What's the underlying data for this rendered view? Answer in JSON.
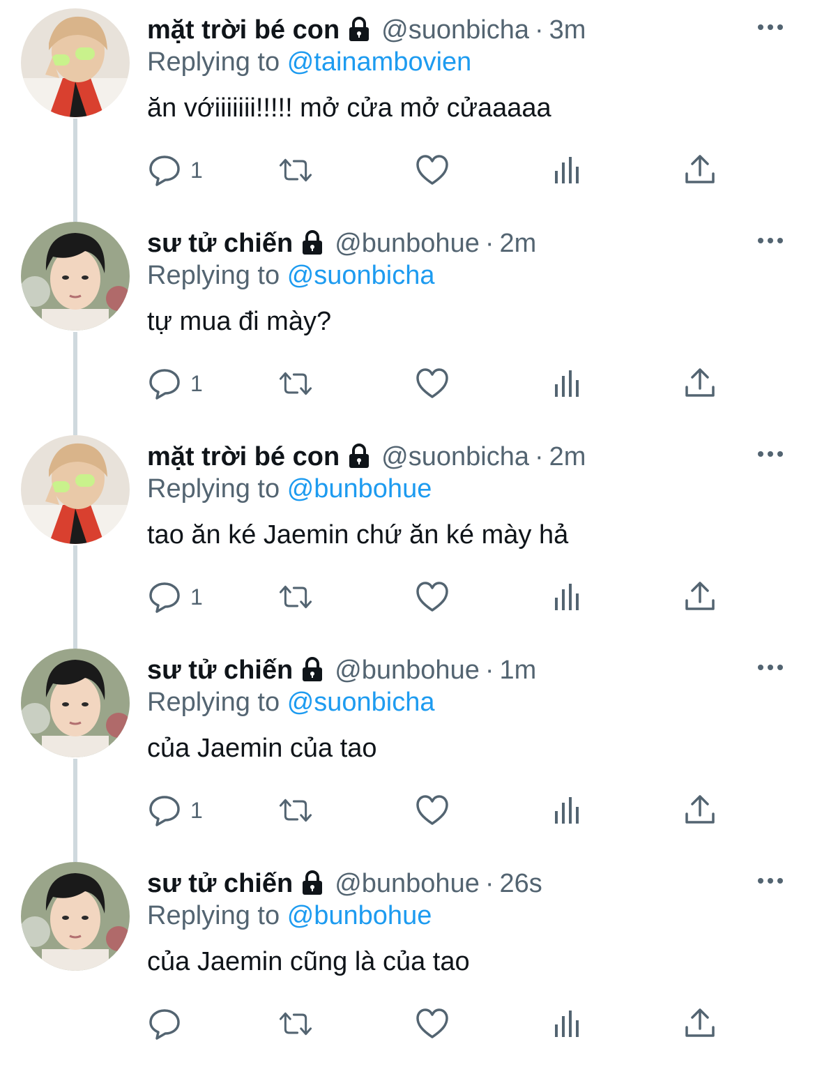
{
  "colors": {
    "text": "#0f1419",
    "secondary": "#536471",
    "link": "#1d9bf0",
    "thread_line": "#cfd9de",
    "icon": "#536471"
  },
  "tweets": [
    {
      "name": "mặt trời bé con",
      "handle": "@suonbicha",
      "time": "3m",
      "replying_prefix": "Replying to",
      "reply_to": "@tainambovien",
      "text": "ăn vớiiiiiii!!!!! mở cửa mở cửaaaaa",
      "reply_count": "1",
      "avatar": "sun-avatar",
      "locked": true
    },
    {
      "name": "sư tử chiến",
      "handle": "@bunbohue",
      "time": "2m",
      "replying_prefix": "Replying to",
      "reply_to": "@suonbicha",
      "text": "tự mua đi mày?",
      "reply_count": "1",
      "avatar": "lion-avatar",
      "locked": true
    },
    {
      "name": "mặt trời bé con",
      "handle": "@suonbicha",
      "time": "2m",
      "replying_prefix": "Replying to",
      "reply_to": "@bunbohue",
      "text": "tao ăn ké Jaemin chứ ăn ké mày hả",
      "reply_count": "1",
      "avatar": "sun-avatar",
      "locked": true
    },
    {
      "name": "sư tử chiến",
      "handle": "@bunbohue",
      "time": "1m",
      "replying_prefix": "Replying to",
      "reply_to": "@suonbicha",
      "text": "của Jaemin của tao",
      "reply_count": "1",
      "avatar": "lion-avatar",
      "locked": true
    },
    {
      "name": "sư tử chiến",
      "handle": "@bunbohue",
      "time": "26s",
      "replying_prefix": "Replying to",
      "reply_to": "@bunbohue",
      "text": "của Jaemin cũng là của tao",
      "reply_count": "",
      "avatar": "lion-avatar",
      "locked": true
    }
  ],
  "dot_separator": "·",
  "icons": [
    "lock-icon",
    "more-icon",
    "reply-icon",
    "retweet-icon",
    "like-icon",
    "views-icon",
    "share-icon"
  ]
}
